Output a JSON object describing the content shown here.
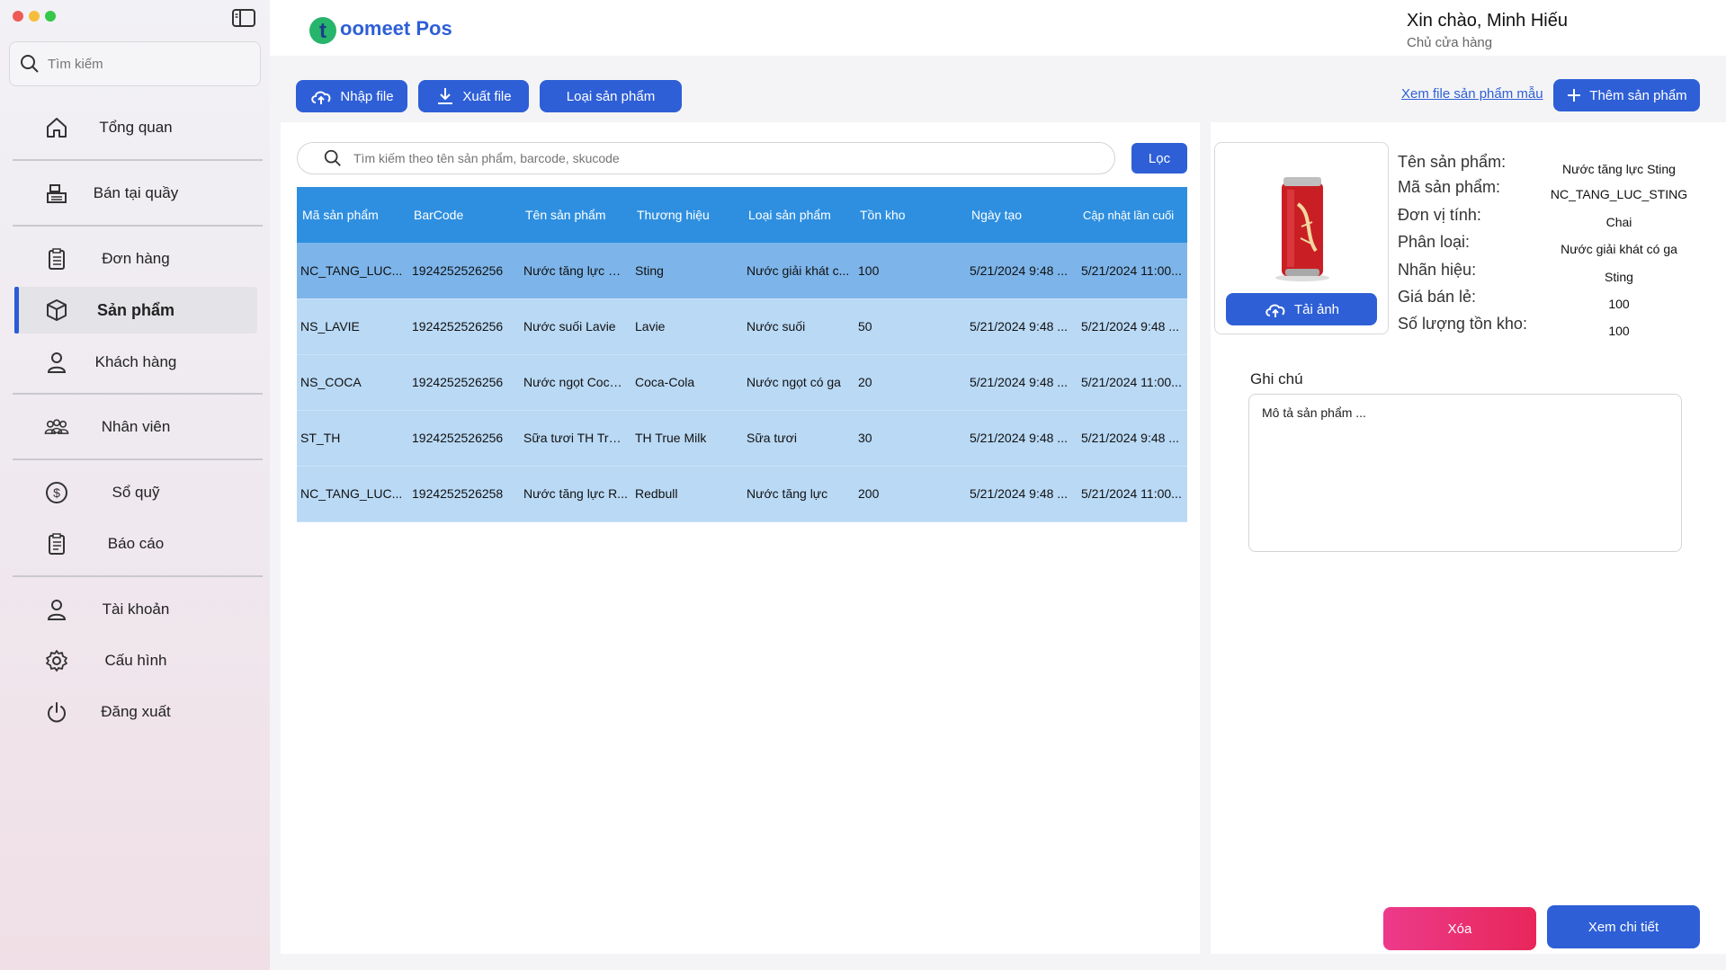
{
  "window": {
    "colors": {
      "close": "#ee5b56",
      "minimize": "#f6bd3b",
      "maximize": "#35c849"
    }
  },
  "sidebar": {
    "search_placeholder": "Tìm kiếm",
    "items": [
      {
        "label": "Tổng quan",
        "icon": "home-icon"
      },
      {
        "label": "Bán tại quầy",
        "icon": "cash-register-icon"
      },
      {
        "label": "Đơn hàng",
        "icon": "clipboard-icon"
      },
      {
        "label": "Sản phẩm",
        "icon": "box-icon",
        "active": true
      },
      {
        "label": "Khách hàng",
        "icon": "user-icon"
      },
      {
        "label": "Nhân viên",
        "icon": "users-group-icon"
      },
      {
        "label": "Sổ quỹ",
        "icon": "dollar-circle-icon"
      },
      {
        "label": "Báo cáo",
        "icon": "report-icon"
      },
      {
        "label": "Tài khoản",
        "icon": "account-icon"
      },
      {
        "label": "Cấu hình",
        "icon": "gear-icon"
      },
      {
        "label": "Đăng xuất",
        "icon": "power-icon"
      }
    ]
  },
  "header": {
    "logo_letter": "t",
    "logo_text": "oomeet Pos",
    "greeting": "Xin chào, Minh Hiếu",
    "role": "Chủ cửa hàng"
  },
  "toolbar": {
    "import_label": "Nhập file",
    "export_label": "Xuất file",
    "category_label": "Loại sản phẩm",
    "sample_link": "Xem file sản phẩm mẫu",
    "add_label": "Thêm sản phẩm"
  },
  "table": {
    "search_placeholder": "Tìm kiếm theo tên sản phẩm, barcode, skucode",
    "filter_label": "Lọc",
    "columns": [
      "Mã sản phẩm",
      "BarCode",
      "Tên sản phẩm",
      "Thương hiệu",
      "Loại sản phẩm",
      "Tồn kho",
      "Ngày tạo",
      "Cập nhật lần cuối"
    ],
    "rows": [
      [
        "NC_TANG_LUC...",
        "1924252526256",
        "Nước tăng lực Sti...",
        "Sting",
        "Nước giải khát c...",
        "100",
        "5/21/2024 9:48 ...",
        "5/21/2024 11:00..."
      ],
      [
        "NS_LAVIE",
        "1924252526256",
        "Nước suối Lavie",
        "Lavie",
        "Nước suối",
        "50",
        "5/21/2024 9:48 ...",
        "5/21/2024 9:48 ..."
      ],
      [
        "NS_COCA",
        "1924252526256",
        "Nước ngọt Coca-...",
        "Coca-Cola",
        "Nước ngọt có ga",
        "20",
        "5/21/2024 9:48 ...",
        "5/21/2024 11:00..."
      ],
      [
        "ST_TH",
        "1924252526256",
        "Sữa tươi TH True...",
        "TH True Milk",
        "Sữa tươi",
        "30",
        "5/21/2024 9:48 ...",
        "5/21/2024 9:48 ..."
      ],
      [
        "NC_TANG_LUC...",
        "1924252526258",
        "Nước tăng lực R...",
        "Redbull",
        "Nước tăng lực",
        "200",
        "5/21/2024 9:48 ...",
        "5/21/2024 11:00..."
      ]
    ],
    "selected_row": 0
  },
  "detail": {
    "upload_label": "Tải ảnh",
    "fields": [
      {
        "label": "Tên sản phẩm:",
        "value": "Nước tăng lực Sting"
      },
      {
        "label": "Mã sản phẩm:",
        "value": "NC_TANG_LUC_STING"
      },
      {
        "label": "Đơn vị tính:",
        "value": "Chai"
      },
      {
        "label": "Phân loại:",
        "value": "Nước giải khát có ga"
      },
      {
        "label": "Nhãn hiệu:",
        "value": "Sting"
      },
      {
        "label": "Giá bán lẻ:",
        "value": "100"
      },
      {
        "label": "Số lượng tồn kho:",
        "value": "100"
      }
    ],
    "note_title": "Ghi chú",
    "note_value": "Mô tả sản phẩm ...",
    "delete_label": "Xóa",
    "view_label": "Xem chi tiết"
  }
}
